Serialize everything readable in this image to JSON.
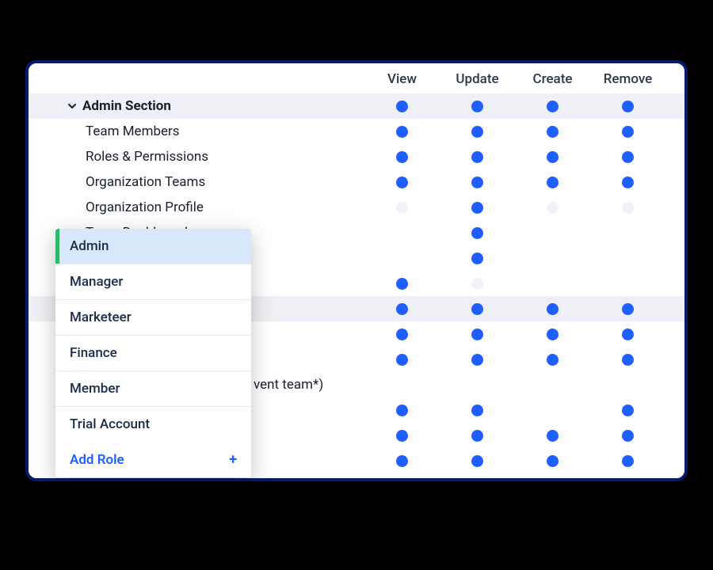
{
  "columns": [
    "View",
    "Update",
    "Create",
    "Remove"
  ],
  "rows": [
    {
      "label": "Admin Section",
      "type": "section",
      "chev": true,
      "perms": [
        "on",
        "on",
        "on",
        "on"
      ]
    },
    {
      "label": "Team Members",
      "type": "child",
      "perms": [
        "on",
        "on",
        "on",
        "on"
      ]
    },
    {
      "label": "Roles & Permissions",
      "type": "child",
      "perms": [
        "on",
        "on",
        "on",
        "on"
      ]
    },
    {
      "label": "Organization Teams",
      "type": "child",
      "perms": [
        "on",
        "on",
        "on",
        "on"
      ]
    },
    {
      "label": "Organization Profile",
      "type": "child",
      "perms": [
        "off",
        "on",
        "off",
        "off"
      ]
    },
    {
      "label": "Team Dashboards",
      "type": "child",
      "perms": [
        "",
        "on",
        "",
        ""
      ]
    },
    {
      "label": "",
      "type": "child",
      "perms": [
        "",
        "on",
        "",
        ""
      ]
    },
    {
      "label": "",
      "type": "child",
      "perms": [
        "on",
        "off",
        "",
        ""
      ]
    },
    {
      "label": "",
      "type": "group",
      "chev": true,
      "perms": [
        "on",
        "on",
        "on",
        "on"
      ]
    },
    {
      "label": "",
      "type": "child",
      "perms": [
        "on",
        "on",
        "on",
        "on"
      ]
    },
    {
      "label": "",
      "type": "child",
      "perms": [
        "on",
        "on",
        "on",
        "on"
      ]
    },
    {
      "label": "vent team*)",
      "type": "child",
      "indent_extra": true,
      "perms": [
        "",
        "",
        "",
        ""
      ]
    },
    {
      "label": "",
      "type": "child",
      "perms": [
        "on",
        "on",
        "",
        "on"
      ]
    },
    {
      "label": "",
      "type": "child",
      "perms": [
        "on",
        "on",
        "on",
        "on"
      ]
    },
    {
      "label": "",
      "type": "child",
      "perms": [
        "on",
        "on",
        "on",
        "on"
      ]
    }
  ],
  "dropdown": {
    "items": [
      {
        "label": "Admin",
        "selected": true
      },
      {
        "label": "Manager"
      },
      {
        "label": "Marketeer"
      },
      {
        "label": "Finance"
      },
      {
        "label": "Member"
      },
      {
        "label": "Trial Account"
      }
    ],
    "add_label": "Add Role"
  }
}
